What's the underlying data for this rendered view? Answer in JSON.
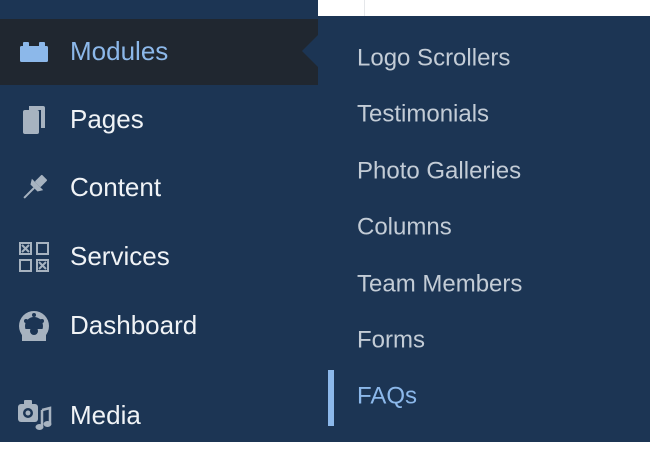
{
  "colors": {
    "sidebar_bg": "#1c3554",
    "active_item_bg": "#202730",
    "active_accent": "#8cb8ea",
    "menu_text": "#f0f3f6",
    "submenu_text": "#c3ccd6",
    "icon_color": "#a7b3c0"
  },
  "sidebar": {
    "items": [
      {
        "label": "Modules",
        "icon": "puzzle-block-icon",
        "active": true
      },
      {
        "label": "Pages",
        "icon": "pages-icon",
        "active": false
      },
      {
        "label": "Content",
        "icon": "pin-icon",
        "active": false
      },
      {
        "label": "Services",
        "icon": "grid-icon",
        "active": false
      },
      {
        "label": "Dashboard",
        "icon": "gauge-icon",
        "active": false
      },
      {
        "label": "Media",
        "icon": "media-icon",
        "active": false
      }
    ]
  },
  "submenu": {
    "items": [
      {
        "label": "Logo Scrollers",
        "current": false
      },
      {
        "label": "Testimonials",
        "current": false
      },
      {
        "label": "Photo Galleries",
        "current": false
      },
      {
        "label": "Columns",
        "current": false
      },
      {
        "label": "Team Members",
        "current": false
      },
      {
        "label": "Forms",
        "current": false
      },
      {
        "label": "FAQs",
        "current": true
      }
    ]
  }
}
